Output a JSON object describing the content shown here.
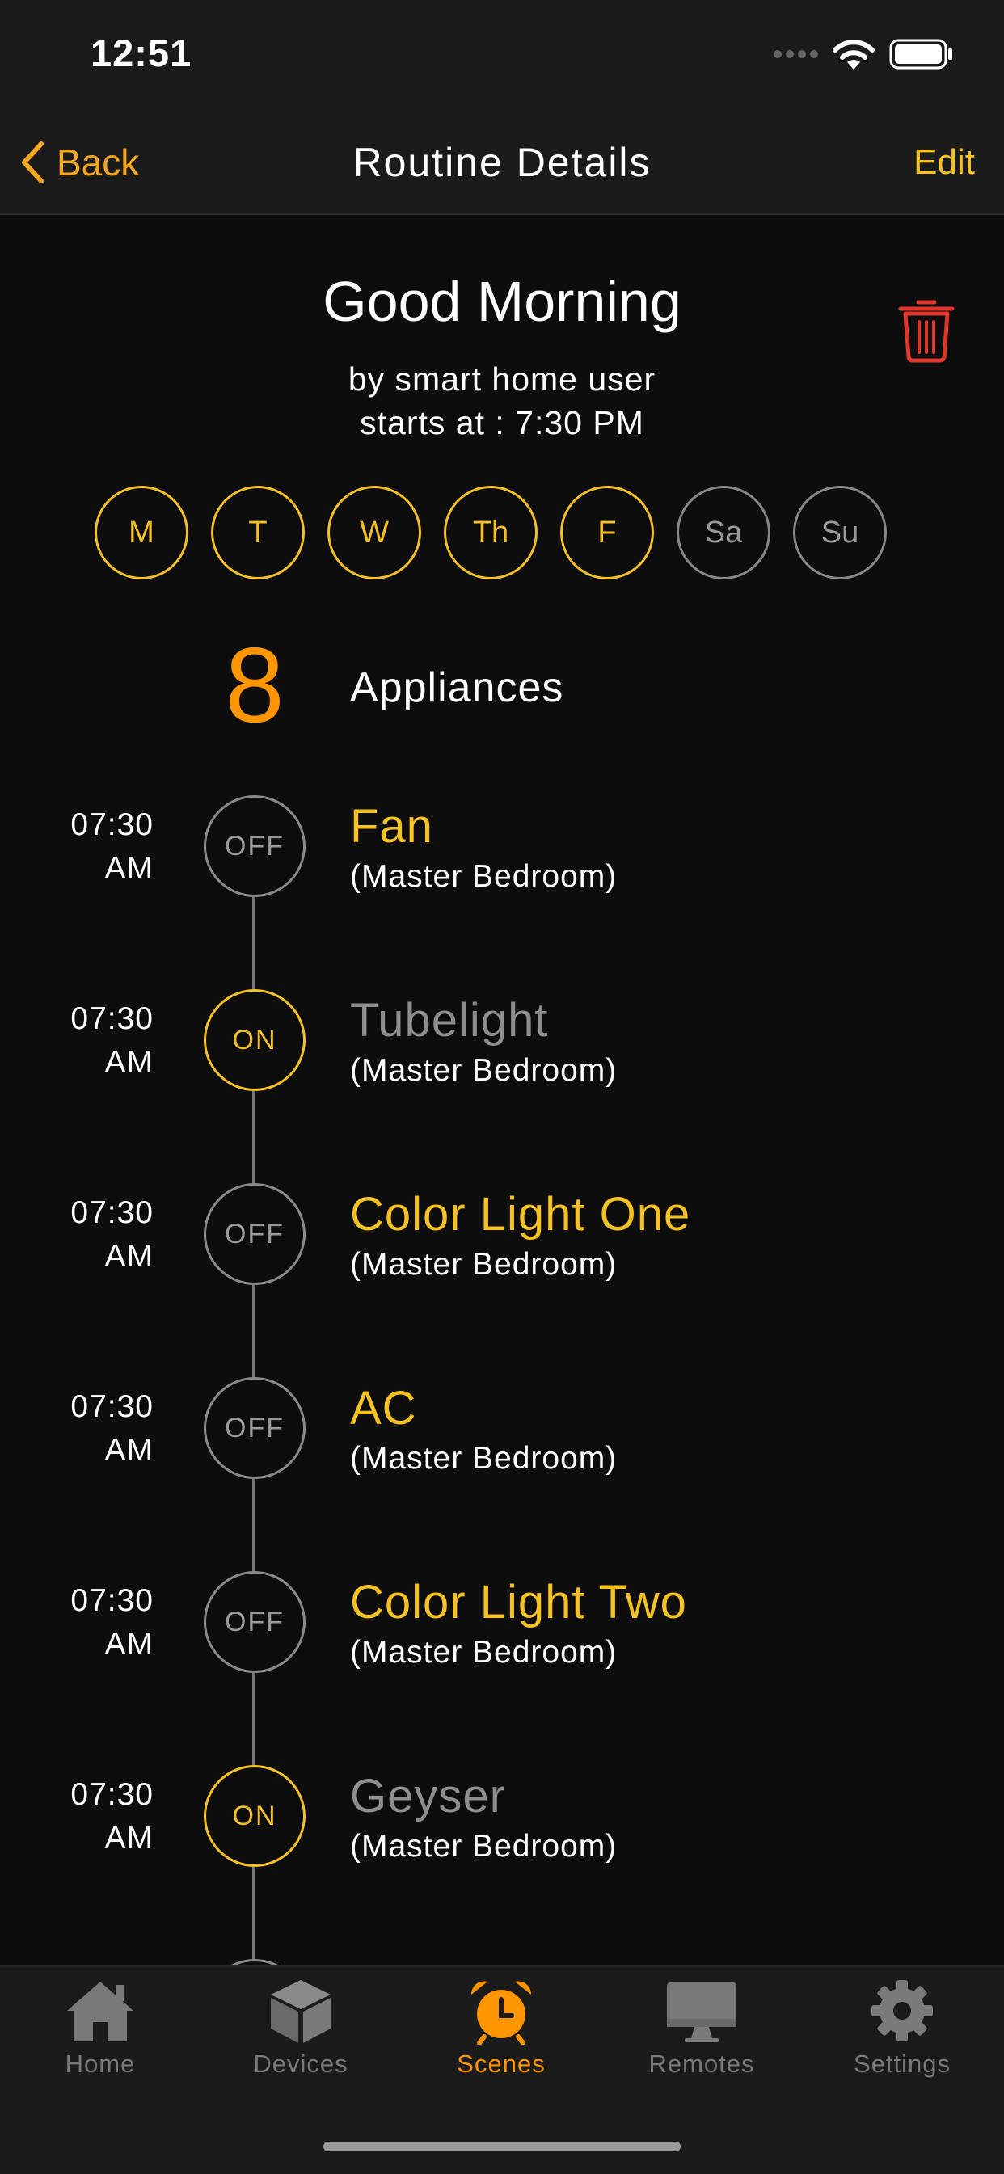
{
  "status": {
    "time": "12:51"
  },
  "nav": {
    "back_label": "Back",
    "title": "Routine Details",
    "edit_label": "Edit"
  },
  "routine": {
    "name": "Good Morning",
    "author": "by smart home user",
    "starts": "starts at : 7:30 PM"
  },
  "days": [
    {
      "label": "M",
      "active": true
    },
    {
      "label": "T",
      "active": true
    },
    {
      "label": "W",
      "active": true
    },
    {
      "label": "Th",
      "active": true
    },
    {
      "label": "F",
      "active": true
    },
    {
      "label": "Sa",
      "active": false
    },
    {
      "label": "Su",
      "active": false
    }
  ],
  "appliances": {
    "count": "8",
    "label": "Appliances",
    "items": [
      {
        "time_hm": "07:30",
        "time_ampm": "AM",
        "state": "OFF",
        "name": "Fan",
        "room": "(Master Bedroom)"
      },
      {
        "time_hm": "07:30",
        "time_ampm": "AM",
        "state": "ON",
        "name": "Tubelight",
        "room": "(Master Bedroom)"
      },
      {
        "time_hm": "07:30",
        "time_ampm": "AM",
        "state": "OFF",
        "name": "Color Light One",
        "room": "(Master Bedroom)"
      },
      {
        "time_hm": "07:30",
        "time_ampm": "AM",
        "state": "OFF",
        "name": "AC",
        "room": "(Master Bedroom)"
      },
      {
        "time_hm": "07:30",
        "time_ampm": "AM",
        "state": "OFF",
        "name": "Color Light Two",
        "room": "(Master Bedroom)"
      },
      {
        "time_hm": "07:30",
        "time_ampm": "AM",
        "state": "ON",
        "name": "Geyser",
        "room": "(Master Bedroom)"
      }
    ]
  },
  "tabs": [
    {
      "label": "Home",
      "icon": "home-icon"
    },
    {
      "label": "Devices",
      "icon": "cube-icon"
    },
    {
      "label": "Scenes",
      "icon": "alarm-clock-icon",
      "active": true
    },
    {
      "label": "Remotes",
      "icon": "monitor-icon"
    },
    {
      "label": "Settings",
      "icon": "gear-icon"
    }
  ],
  "colors": {
    "accent": "#f5c223",
    "orange": "#ff9500",
    "delete": "#e0352b",
    "background": "#0d0d0d"
  }
}
